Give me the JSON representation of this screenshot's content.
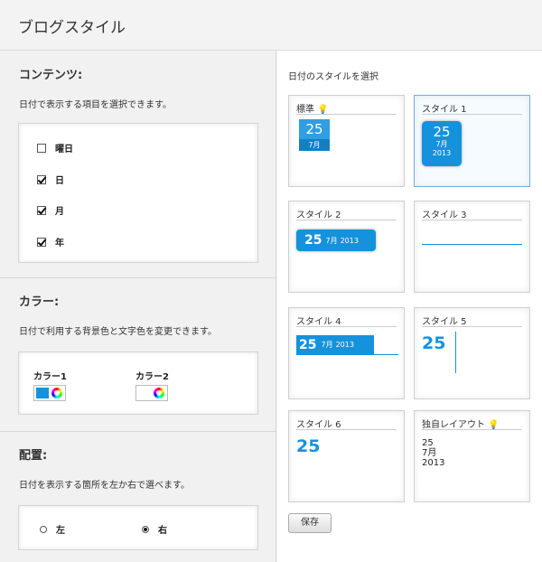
{
  "header": {
    "title": "ブログスタイル"
  },
  "contents": {
    "title": "コンテンツ:",
    "description": "日付で表示する項目を選択できます。",
    "items": [
      {
        "label": "曜日",
        "checked": false
      },
      {
        "label": "日",
        "checked": true
      },
      {
        "label": "月",
        "checked": true
      },
      {
        "label": "年",
        "checked": true
      }
    ]
  },
  "color": {
    "title": "カラー:",
    "description": "日付で利用する背景色と文字色を変更できます。",
    "color1_label": "カラー1",
    "color2_label": "カラー2",
    "color1_value": "#1592dc",
    "color2_value": "#ffffff"
  },
  "placement": {
    "title": "配置:",
    "description": "日付を表示する箇所を左か右で選べます。",
    "options": [
      {
        "label": "左",
        "selected": false
      },
      {
        "label": "右",
        "selected": true
      }
    ]
  },
  "styles": {
    "title": "日付のスタイルを選択",
    "day": "25",
    "month": "7月",
    "year": "2013",
    "cards": [
      {
        "label": "標準"
      },
      {
        "label": "スタイル 1"
      },
      {
        "label": "スタイル 2"
      },
      {
        "label": "スタイル 3"
      },
      {
        "label": "スタイル 4"
      },
      {
        "label": "スタイル 5"
      },
      {
        "label": "スタイル 6"
      },
      {
        "label": "独自レイアウト"
      }
    ],
    "selected_index": 1
  },
  "save_label": "保存",
  "accent_color": "#1592dc"
}
